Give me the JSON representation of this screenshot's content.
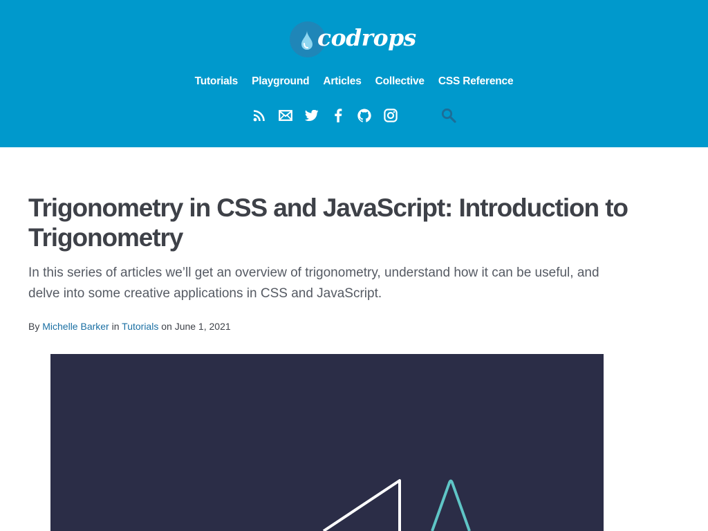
{
  "header": {
    "logo_text": "codrops",
    "nav": [
      {
        "label": "Tutorials"
      },
      {
        "label": "Playground"
      },
      {
        "label": "Articles"
      },
      {
        "label": "Collective"
      },
      {
        "label": "CSS Reference"
      }
    ],
    "social_icons": [
      "rss-icon",
      "mail-icon",
      "twitter-icon",
      "facebook-icon",
      "github-icon",
      "instagram-icon"
    ],
    "search_icon": "search-icon",
    "colors": {
      "background": "#0099cc",
      "logo_circle": "#1f86b8",
      "search_icon": "#1c6e98"
    }
  },
  "article": {
    "title": "Trigonometry in CSS and JavaScript: Introduction to Trigonometry",
    "excerpt": "In this series of articles we’ll get an overview of trigonometry, understand how it can be useful, and delve into some creative applications in CSS and JavaScript.",
    "byline": {
      "prefix": "By",
      "author": "Michelle Barker",
      "in_text": "in",
      "category": "Tutorials",
      "on_text": "on",
      "date": "June 1, 2021"
    },
    "hero": {
      "background": "#2b2d47",
      "shape_colors": [
        "#ffffff",
        "#5fc5c6"
      ]
    }
  }
}
